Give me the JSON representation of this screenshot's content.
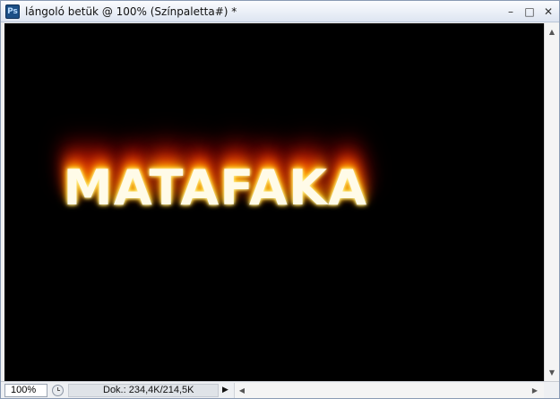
{
  "window": {
    "app_icon": "photoshop-icon",
    "app_icon_label": "Ps",
    "title": "lángoló betük  @ 100% (Színpaletta#) *",
    "minimize_label": "–",
    "maximize_label": "□",
    "close_label": "✕"
  },
  "canvas": {
    "background_color": "#000000",
    "text": "MATAFAKA"
  },
  "scrollbars": {
    "up_arrow": "▲",
    "down_arrow": "▼",
    "left_arrow": "◀",
    "right_arrow": "▶"
  },
  "statusbar": {
    "zoom_value": "100%",
    "zoom_icon": "clock-icon",
    "doc_info": "Dok.: 234,4K/214,5K",
    "menu_arrow": "▶"
  }
}
